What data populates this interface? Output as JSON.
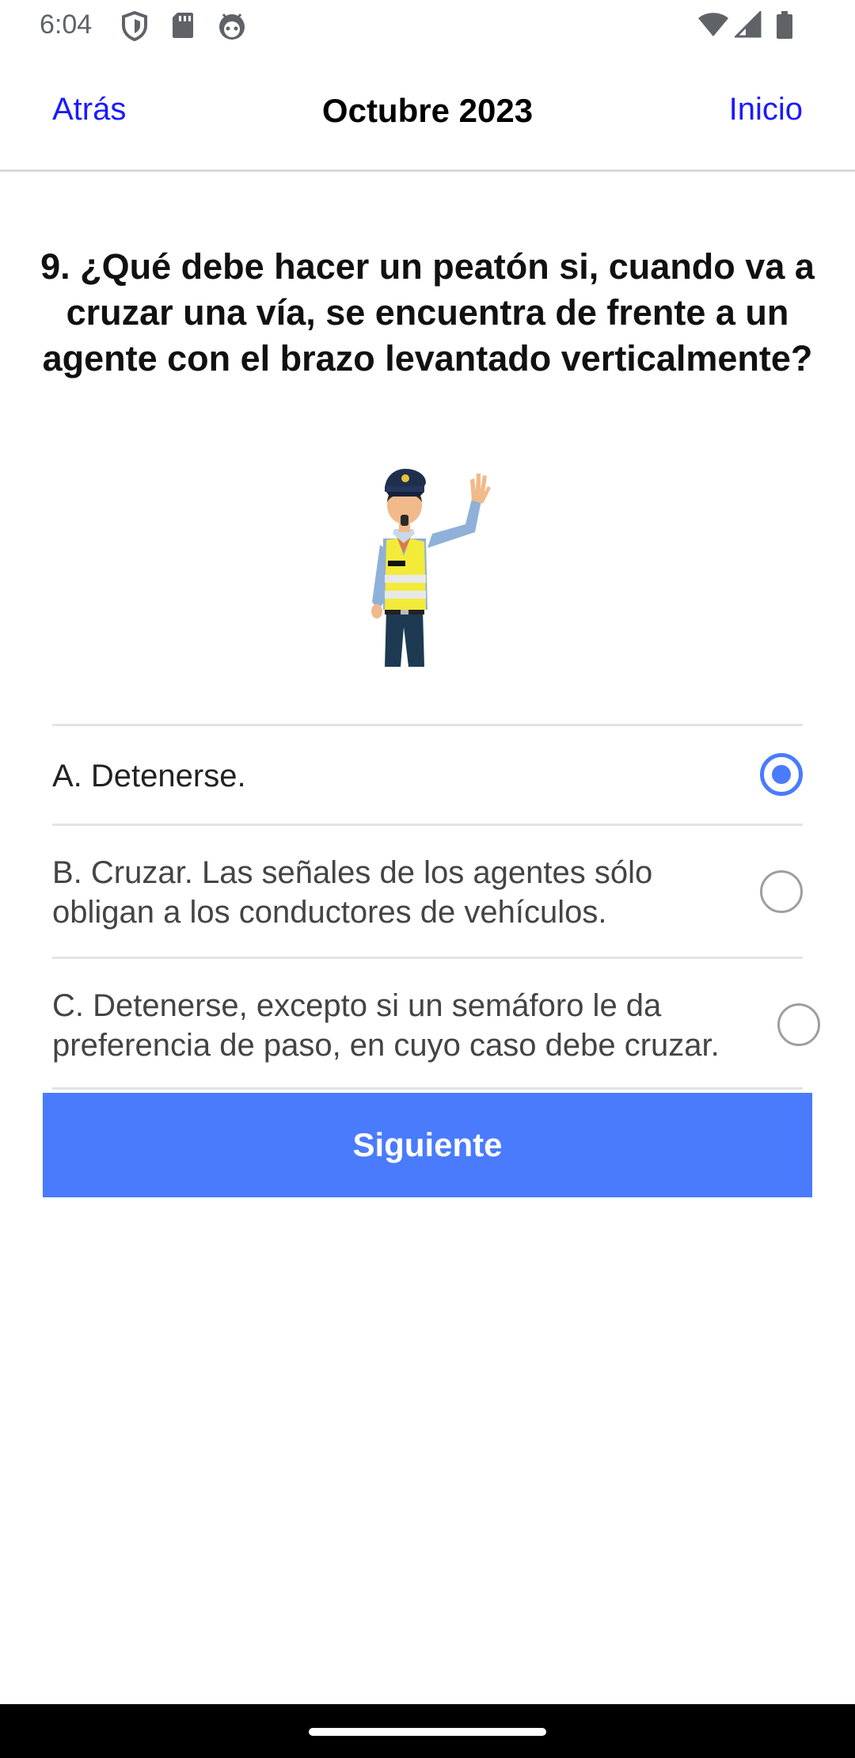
{
  "status": {
    "time": "6:04",
    "icons": [
      "shield-icon",
      "sd-card-icon",
      "android-face-icon",
      "wifi-icon",
      "signal-icon",
      "battery-icon"
    ]
  },
  "nav": {
    "back_label": "Atrás",
    "title": "Octubre 2023",
    "home_label": "Inicio",
    "link_color": "#1a1aff"
  },
  "question": {
    "text": "9. ¿Qué debe hacer un peatón si, cuando va a cruzar una vía, se encuentra de frente a un agente con el brazo levantado verticalmente?",
    "image": "traffic-officer-raised-arm-illustration"
  },
  "options": [
    {
      "text": "A. Detenerse.",
      "selected": true
    },
    {
      "text": "B. Cruzar. Las señales de los agentes sólo obligan a los conductores de vehículos.",
      "selected": false
    },
    {
      "text": "C. Detenerse, excepto si un semáforo le da preferencia de paso, en cuyo caso debe cruzar.",
      "selected": false
    }
  ],
  "button": {
    "label": "Siguiente",
    "color": "#4a7bfd"
  }
}
